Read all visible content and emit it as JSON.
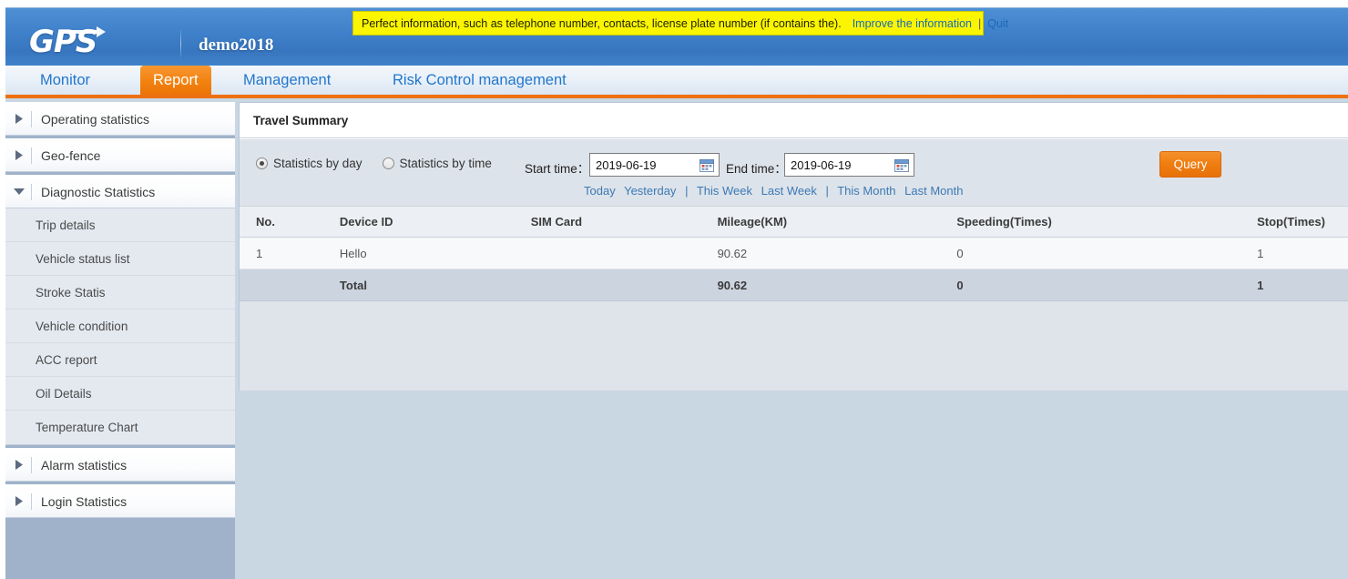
{
  "header": {
    "logo_text": "GPS",
    "account_name": "demo2018"
  },
  "notice": {
    "message": "Perfect information, such as telephone number, contacts, license plate number (if contains the).",
    "improve_link": "Improve the information",
    "separator": "|",
    "quit_link": "Quit",
    "bg_color": "#fbf500"
  },
  "nav": {
    "items": [
      {
        "label": "Monitor",
        "active": false
      },
      {
        "label": "Report",
        "active": true
      },
      {
        "label": "Management",
        "active": false
      },
      {
        "label": "Risk Control management",
        "active": false
      }
    ],
    "accent_color": "#ee7012",
    "link_color": "#2277cc"
  },
  "sidebar": {
    "groups": [
      {
        "label": "Operating statistics",
        "expanded": false,
        "icon": "chevron-right-icon",
        "items": []
      },
      {
        "label": "Geo-fence",
        "expanded": false,
        "icon": "chevron-right-icon",
        "items": []
      },
      {
        "label": "Diagnostic Statistics",
        "expanded": true,
        "icon": "chevron-down-icon",
        "items": [
          "Trip details",
          "Vehicle status list",
          "Stroke Statis",
          "Vehicle condition",
          "ACC report",
          "Oil Details",
          "Temperature Chart"
        ]
      },
      {
        "label": "Alarm statistics",
        "expanded": false,
        "icon": "chevron-right-icon",
        "items": []
      },
      {
        "label": "Login Statistics",
        "expanded": false,
        "icon": "chevron-right-icon",
        "items": []
      }
    ]
  },
  "panel": {
    "title": "Travel Summary",
    "toolbar": {
      "radio_by_day": "Statistics by day",
      "radio_by_time": "Statistics by time",
      "radio_selected": "by_day",
      "start_time_label": "Start time：",
      "start_time_value": "2019-06-19",
      "end_time_label": "End time：",
      "end_time_value": "2019-06-19",
      "query_button": "Query",
      "quick_links": [
        "Today",
        "Yesterday",
        "This Week",
        "Last Week",
        "This Month",
        "Last Month"
      ],
      "quick_separator": "|"
    },
    "table": {
      "columns": [
        "No.",
        "Device ID",
        "SIM Card",
        "Mileage(KM)",
        "Speeding(Times)",
        "Stop(Times)"
      ],
      "rows": [
        {
          "no": "1",
          "device_id": "Hello",
          "sim_card": "",
          "mileage": "90.62",
          "speeding": "0",
          "stop": "1"
        }
      ],
      "total": {
        "no": "",
        "device_id": "Total",
        "sim_card": "",
        "mileage": "90.62",
        "speeding": "0",
        "stop": "1"
      }
    }
  }
}
